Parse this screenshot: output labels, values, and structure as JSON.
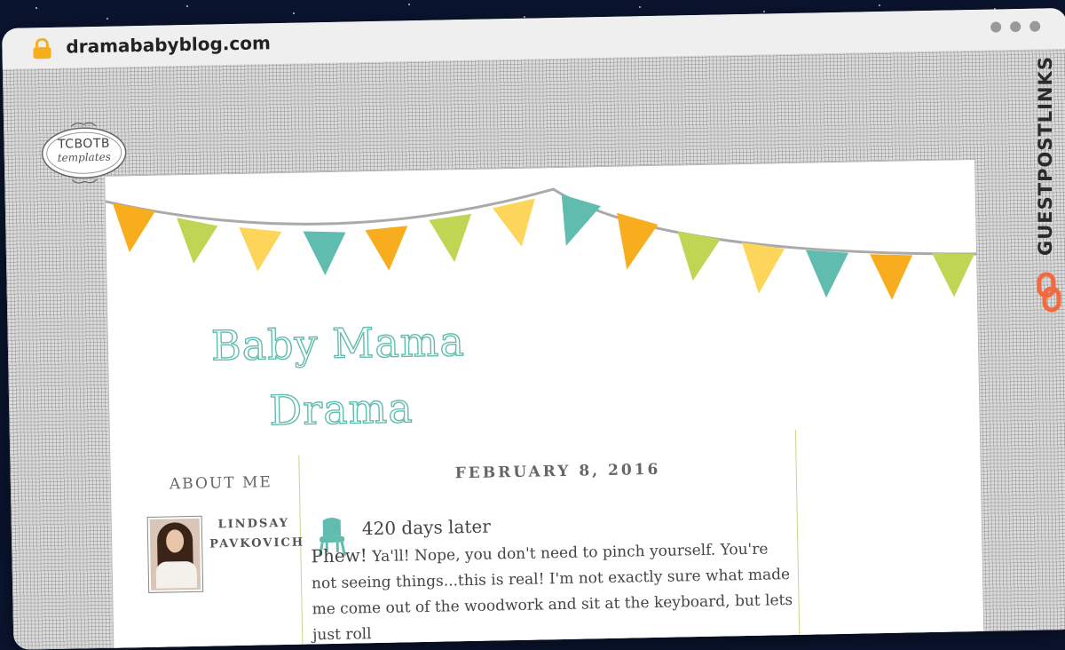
{
  "browser": {
    "url": "dramababyblog.com"
  },
  "badge": {
    "line1": "TCBOTB",
    "line2": "templates"
  },
  "blog": {
    "title_line1": "Baby Mama",
    "title_line2": "Drama"
  },
  "sidebar": {
    "heading": "ABOUT ME",
    "name_line1": "LINDSAY",
    "name_line2": "PAVKOVICH"
  },
  "post": {
    "date": "FEBRUARY 8, 2016",
    "title": "420 days later",
    "first_word": "Phew!",
    "body": "Ya'll! Nope, you don't need to pinch yourself.  You're not seeing things...this is real! I'm not exactly sure what made me come out of the woodwork and sit at the keyboard, but lets just roll"
  },
  "watermark": {
    "text": "GUESTPOSTLINKS"
  },
  "colors": {
    "teal": "#5fbcae",
    "orange": "#f7ad1e",
    "green": "#bfd553",
    "yellow": "#fcd55a",
    "brand_orange": "#f26a3d"
  },
  "icons": [
    "lock-icon",
    "chair-icon",
    "link-icon"
  ]
}
